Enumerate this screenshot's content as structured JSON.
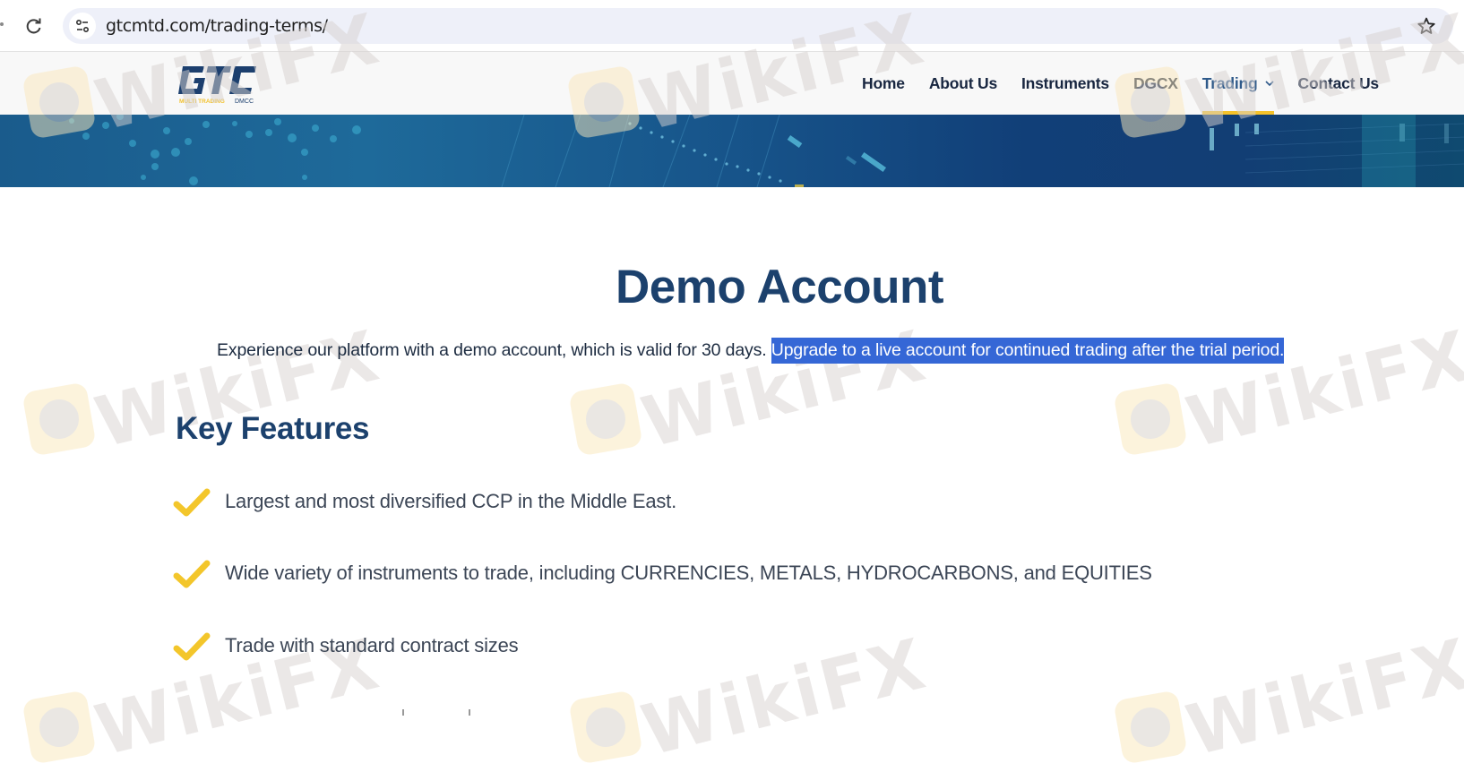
{
  "browser": {
    "url": "gtcmtd.com/trading-terms/",
    "icons": {
      "reload": "reload-icon",
      "site_info": "site-settings-icon",
      "bookmark": "star-outline-icon"
    }
  },
  "site": {
    "logo": {
      "mark": "GTC",
      "tagline_colored": "MULTI TRADING",
      "tagline_plain": "DMCC"
    },
    "nav": [
      {
        "label": "Home",
        "active": false
      },
      {
        "label": "About Us",
        "active": false
      },
      {
        "label": "Instruments",
        "active": false
      },
      {
        "label": "DGCX",
        "active": false
      },
      {
        "label": "Trading",
        "active": true,
        "has_dropdown": true
      },
      {
        "label": "Contact Us",
        "active": false
      }
    ],
    "colors": {
      "brand_navy": "#1c416d",
      "accent_yellow": "#f5c22a",
      "selection_blue": "#3567d6"
    }
  },
  "main": {
    "title": "Demo Account",
    "intro_plain": "Experience our platform with a demo account, which is valid for 30 days.",
    "intro_selected": "Upgrade to a live account for continued trading after the trial period.",
    "section_title": "Key Features",
    "features": [
      {
        "icon": "check-icon",
        "text": "Largest and most diversified CCP in the Middle East."
      },
      {
        "icon": "check-icon",
        "text": "Wide variety of instruments to trade, including CURRENCIES, METALS, HYDROCARBONS, and EQUITIES"
      },
      {
        "icon": "check-icon",
        "text": "Trade with standard contract sizes"
      }
    ]
  },
  "watermark": {
    "text": "WikiFX"
  }
}
